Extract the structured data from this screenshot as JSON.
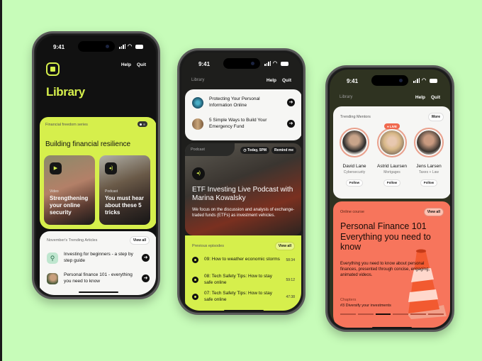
{
  "colors": {
    "background": "#c7fcb9",
    "accent_lime": "#d6ef4c",
    "accent_coral": "#f7755c",
    "live_red": "#f0694e"
  },
  "status_bar": {
    "time": "9:41"
  },
  "nav": {
    "help": "Help",
    "quit": "Quit",
    "library": "Library"
  },
  "phone1": {
    "title": "Library",
    "logo_icon": "book-icon",
    "series": {
      "label": "Financial freedom series",
      "heading": "Building financial resilience",
      "pager": {
        "current": 1,
        "total": 2
      },
      "cards": [
        {
          "kind": "Video",
          "title": "Strengthening your online security",
          "icon": "play-icon"
        },
        {
          "kind": "Podcast",
          "title": "You must hear about these 5 tricks",
          "icon": "audio-icon"
        }
      ]
    },
    "trending": {
      "heading": "November's Trending Articles",
      "view_all": "View all",
      "items": [
        {
          "title": "Investing for beginners - a step by step guide",
          "icon": "magnifier-icon"
        },
        {
          "title": "Personal finance 101 - everything you need to know",
          "icon": "person-thumbnail"
        }
      ]
    }
  },
  "phone2": {
    "articles": [
      {
        "title": "Protecting Your Personal Information Online"
      },
      {
        "title": "5 Simple Ways to Build Your Emergency Fund"
      }
    ],
    "podcast": {
      "label": "Podcast",
      "time_chip": "Today, 5PM",
      "remind_chip": "Remind me",
      "title": "ETF Investing Live Podcast with Marina Kowalsky",
      "description": "We focus on the discussion and analysis of exchange-traded funds (ETFs) as investment vehicles."
    },
    "episodes": {
      "heading": "Previous episodes",
      "view_all": "View all",
      "items": [
        {
          "title": "09: How to weather economic storms",
          "duration": "58:34"
        },
        {
          "title": "08: Tech Safety Tips: How to stay safe online",
          "duration": "59:12"
        },
        {
          "title": "07: Tech Safety Tips: How to stay safe online",
          "duration": "47:38"
        }
      ]
    }
  },
  "phone3": {
    "mentors": {
      "heading": "Trending Mentors",
      "more": "More",
      "live_label": "LIVE",
      "follow_label": "Follow",
      "items": [
        {
          "name": "David Lane",
          "role": "Cybersecurity",
          "live": false
        },
        {
          "name": "Astrid Laursen",
          "role": "Mortgages",
          "live": true
        },
        {
          "name": "Jens Larsen",
          "role": "Taxes + Law",
          "live": false
        }
      ]
    },
    "course": {
      "label": "Online course",
      "view_all": "View all",
      "title": "Personal Finance 101 Everything you need to know",
      "description": "Everything you need to know about personal finances, presented through concise, engaging, animated videos.",
      "chapters_label": "Chapters",
      "current_chapter": "#3 Diversify your investments",
      "progress": {
        "current": 3,
        "total": 6
      }
    }
  }
}
